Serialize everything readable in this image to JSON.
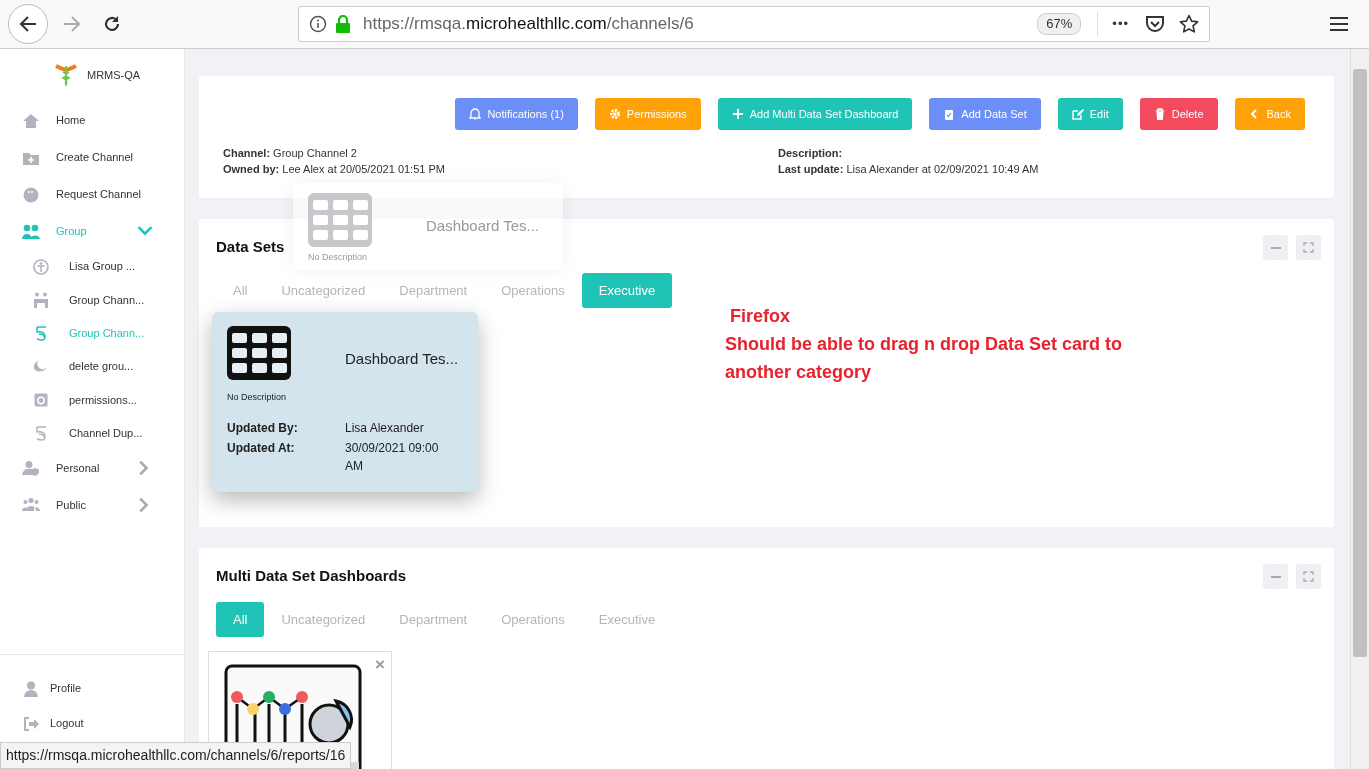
{
  "browser": {
    "url_scheme": "https://rmsqa.",
    "url_domain": "microhealthllc.com",
    "url_path": "/channels/6",
    "zoom": "67%",
    "more": "•••"
  },
  "sidebar": {
    "brand": "MRMS-QA",
    "items": [
      {
        "label": "Home",
        "selected": false
      },
      {
        "label": "Create Channel",
        "selected": false
      },
      {
        "label": "Request Channel",
        "selected": false
      },
      {
        "label": "Group",
        "selected": true,
        "expanded": true,
        "children": [
          {
            "label": "Lisa Group ...",
            "selected": false
          },
          {
            "label": "Group Chann...",
            "selected": false
          },
          {
            "label": "Group Chann...",
            "selected": true
          },
          {
            "label": "delete grou...",
            "selected": false
          },
          {
            "label": "permissions...",
            "selected": false
          },
          {
            "label": "Channel Dup...",
            "selected": false
          }
        ]
      },
      {
        "label": "Personal",
        "selected": false,
        "expanded": false
      },
      {
        "label": "Public",
        "selected": false,
        "expanded": false
      }
    ],
    "footer": [
      {
        "label": "Profile"
      },
      {
        "label": "Logout"
      }
    ]
  },
  "header": {
    "buttons": [
      {
        "label": "Notifications (1)",
        "color": "#6b8ef7"
      },
      {
        "label": "Permissions",
        "color": "#ffa20a"
      },
      {
        "label": "Add Multi Data Set Dashboard",
        "color": "#1fc4b6"
      },
      {
        "label": "Add Data Set",
        "color": "#6b8ef7"
      },
      {
        "label": "Edit",
        "color": "#1fc4b6"
      },
      {
        "label": "Delete",
        "color": "#f44a5e"
      },
      {
        "label": "Back",
        "color": "#ffa20a"
      }
    ],
    "info_left": [
      {
        "label": "Channel:",
        "value": "Group Channel 2"
      },
      {
        "label": "Owned by:",
        "value": "Lee Alex at 20/05/2021 01:51 PM"
      }
    ],
    "info_right": [
      {
        "label": "Description:"
      },
      {
        "label": "Last update:",
        "value": "Lisa Alexander at 02/09/2021 10:49 AM"
      }
    ]
  },
  "data_sets": {
    "title": "Data Sets",
    "tabs": [
      {
        "label": "All",
        "selected": false
      },
      {
        "label": "Uncategorized",
        "selected": false
      },
      {
        "label": "Department",
        "selected": false
      },
      {
        "label": "Operations",
        "selected": false
      },
      {
        "label": "Executive",
        "selected": true
      }
    ],
    "cards": [
      {
        "title": "Dashboard Tes...",
        "description": "No Description",
        "dragging": false
      },
      {
        "title": "Dashboard Tes...",
        "description": "No Description",
        "updated_by_label": "Updated By:",
        "updated_by": "Lisa Alexander",
        "updated_at_label": "Updated At:",
        "updated_at": "30/09/2021 09:00 AM",
        "dragging": true
      }
    ]
  },
  "note": {
    "title": "Firefox",
    "text": "Should be able to drag n drop Data Set card to another category"
  },
  "multi": {
    "title": "Multi Data Set Dashboards",
    "tabs": [
      {
        "label": "All",
        "selected": true
      },
      {
        "label": "Uncategorized",
        "selected": false
      },
      {
        "label": "Department",
        "selected": false
      },
      {
        "label": "Operations",
        "selected": false
      },
      {
        "label": "Executive",
        "selected": false
      }
    ],
    "cards": [
      {
        "close": "×"
      }
    ]
  },
  "status_url": "https://rmsqa.microhealthllc.com/channels/6/reports/16"
}
